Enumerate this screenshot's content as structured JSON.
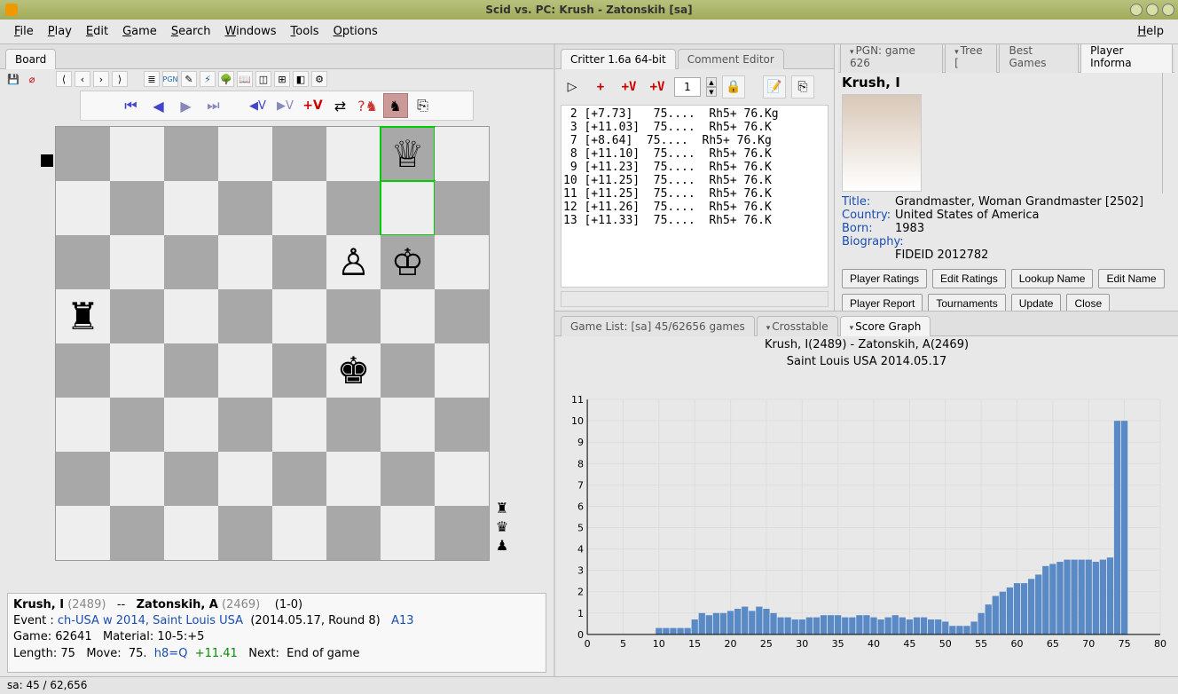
{
  "window": {
    "title": "Scid vs. PC: Krush - Zatonskih [sa]"
  },
  "menus": [
    "File",
    "Play",
    "Edit",
    "Game",
    "Search",
    "Windows",
    "Tools",
    "Options"
  ],
  "menu_right": "Help",
  "left_tab": "Board",
  "engine_tabs": [
    "Critter 1.6a 64-bit",
    "Comment Editor"
  ],
  "right_tabs": [
    "PGN: game 626",
    "Tree [",
    "Best Games",
    "Player Informa"
  ],
  "engine": {
    "spin": "1",
    "lines": [
      " 2 [+7.73]   75....  Rh5+ 76.Kg",
      " 3 [+11.03]  75....  Rh5+ 76.K",
      " 7 [+8.64]  75....  Rh5+ 76.Kg",
      " 8 [+11.10]  75....  Rh5+ 76.K",
      " 9 [+11.23]  75....  Rh5+ 76.K",
      "10 [+11.25]  75....  Rh5+ 76.K",
      "11 [+11.25]  75....  Rh5+ 76.K",
      "12 [+11.26]  75....  Rh5+ 76.K",
      "13 [+11.33]  75....  Rh5+ 76.K"
    ]
  },
  "player": {
    "name": "Krush, I",
    "title_label": "Title:",
    "title_value": "Grandmaster,  Woman Grandmaster  [2502]",
    "country_label": "Country:",
    "country_value": "United States of America",
    "born_label": "Born:",
    "born_value": "1983",
    "bio_label": "Biography:",
    "fideid": "FIDEID 2012782",
    "buttons": [
      "Player Ratings",
      "Edit Ratings",
      "Lookup Name",
      "Edit Name",
      "Player Report",
      "Tournaments",
      "Update",
      "Close"
    ]
  },
  "lower_tabs": [
    "Game List: [sa] 45/62656 games",
    "Crosstable",
    "Score Graph"
  ],
  "chart_header": {
    "line1": "Krush, I(2489) - Zatonskih, A(2469)",
    "line2": "Saint Louis USA  2014.05.17"
  },
  "chart_data": {
    "type": "bar",
    "title": "Score Graph",
    "xlabel": "",
    "ylabel": "",
    "xlim": [
      0,
      80
    ],
    "ylim": [
      0,
      11
    ],
    "x_ticks": [
      0,
      5,
      10,
      15,
      20,
      25,
      30,
      35,
      40,
      45,
      50,
      55,
      60,
      65,
      70,
      75,
      80
    ],
    "y_ticks": [
      0,
      1,
      2,
      3,
      4,
      5,
      6,
      7,
      8,
      9,
      10,
      11
    ],
    "x": [
      10,
      11,
      12,
      13,
      14,
      15,
      16,
      17,
      18,
      19,
      20,
      21,
      22,
      23,
      24,
      25,
      26,
      27,
      28,
      29,
      30,
      31,
      32,
      33,
      34,
      35,
      36,
      37,
      38,
      39,
      40,
      41,
      42,
      43,
      44,
      45,
      46,
      47,
      48,
      49,
      50,
      51,
      52,
      53,
      54,
      55,
      56,
      57,
      58,
      59,
      60,
      61,
      62,
      63,
      64,
      65,
      66,
      67,
      68,
      69,
      70,
      71,
      72,
      73,
      74,
      75
    ],
    "y": [
      0.3,
      0.3,
      0.3,
      0.3,
      0.3,
      0.7,
      1.0,
      0.9,
      1.0,
      1.0,
      1.1,
      1.2,
      1.3,
      1.1,
      1.3,
      1.2,
      1.0,
      0.8,
      0.8,
      0.7,
      0.7,
      0.8,
      0.8,
      0.9,
      0.9,
      0.9,
      0.8,
      0.8,
      0.9,
      0.9,
      0.8,
      0.7,
      0.8,
      0.9,
      0.8,
      0.7,
      0.8,
      0.8,
      0.7,
      0.7,
      0.6,
      0.4,
      0.4,
      0.4,
      0.6,
      1.0,
      1.4,
      1.8,
      2.0,
      2.2,
      2.4,
      2.4,
      2.6,
      2.8,
      3.2,
      3.3,
      3.4,
      3.5,
      3.5,
      3.5,
      3.5,
      3.4,
      3.5,
      3.6,
      10.0,
      10.0
    ]
  },
  "game_info": {
    "white": "Krush, I",
    "white_elo": "(2489)",
    "sep": "--",
    "black": "Zatonskih, A",
    "black_elo": "(2469)",
    "result": "(1-0)",
    "event_lbl": "Event :",
    "event_link": "ch-USA w 2014, Saint Louis USA",
    "event_meta": "(2014.05.17, Round 8)",
    "eco": "A13",
    "game_lbl": "Game:",
    "game_num": "62641",
    "mat_lbl": "Material:",
    "mat_val": "10-5:+5",
    "len_lbl": "Length:",
    "len_val": "75",
    "move_lbl": "Move:",
    "move_val": "75.",
    "move_san": "h8=Q",
    "move_score": "+11.41",
    "next_lbl": "Next:",
    "next_val": "End of game"
  },
  "board": {
    "pieces": [
      {
        "sq": "g8",
        "glyph": "♕",
        "color": "#000",
        "fill": "#fff",
        "hl": true
      },
      {
        "sq": "g7",
        "glyph": "",
        "hl": true
      },
      {
        "sq": "f6",
        "glyph": "♙",
        "color": "#000",
        "fill": "#fff"
      },
      {
        "sq": "g6",
        "glyph": "♔",
        "color": "#000",
        "fill": "#fff"
      },
      {
        "sq": "a5",
        "glyph": "♜",
        "color": "#000"
      },
      {
        "sq": "f4",
        "glyph": "♚",
        "color": "#000"
      }
    ],
    "side_indicator": "black",
    "captured": [
      "♜",
      "♛",
      "♟"
    ]
  },
  "status": "sa:  45 / 62,656"
}
